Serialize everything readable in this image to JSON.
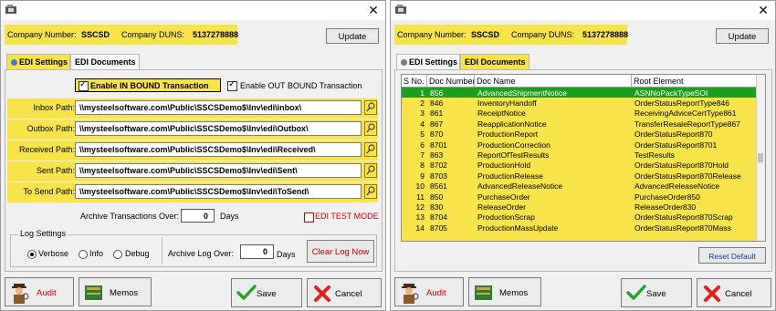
{
  "left_window": {
    "close_glyph": "✕",
    "company": {
      "number_label": "Company Number:",
      "number_value": "SSCSD",
      "duns_label": "Company DUNS:",
      "duns_value": "5137278888"
    },
    "update_button": "Update",
    "tabs": [
      {
        "label": "EDI Settings",
        "active": true
      },
      {
        "label": "EDI Documents",
        "active": false
      }
    ],
    "inbound_checkbox": {
      "label": "Enable IN BOUND Transaction",
      "checked": true
    },
    "outbound_checkbox": {
      "label": "Enable OUT BOUND Transaction",
      "checked": true
    },
    "paths": [
      {
        "label": "Inbox Path:",
        "value": "\\\\mysteelsoftware.com\\Public\\SSCSDemo$\\Inv\\edi\\inbox\\"
      },
      {
        "label": "Outbox Path:",
        "value": "\\\\mysteelsoftware.com\\Public\\SSCSDemo$\\Inv\\edi\\Outbox\\"
      },
      {
        "label": "Received Path:",
        "value": "\\\\mysteelsoftware.com\\Public\\SSCSDemo$\\Inv\\edi\\Received\\"
      },
      {
        "label": "Sent Path:",
        "value": "\\\\mysteelsoftware.com\\Public\\SSCSDemo$\\Inv\\edi\\Sent\\"
      },
      {
        "label": "To Send Path:",
        "value": "\\\\mysteelsoftware.com\\Public\\SSCSDemo$\\Inv\\edi\\ToSend\\"
      }
    ],
    "archive": {
      "label": "Archive Transactions Over:",
      "value": "0",
      "unit": "Days"
    },
    "edi_test_mode": {
      "label": "EDI TEST MODE",
      "checked": false
    },
    "log_settings": {
      "title": "Log Settings",
      "options": [
        {
          "label": "Verbose",
          "selected": true
        },
        {
          "label": "Info",
          "selected": false
        },
        {
          "label": "Debug",
          "selected": false
        }
      ],
      "archive_label": "Archive Log Over:",
      "archive_value": "0",
      "archive_unit": "Days",
      "clear_button": "Clear Log Now"
    },
    "buttons": {
      "audit": "Audit",
      "memos": "Memos",
      "save": "Save",
      "cancel": "Cancel"
    }
  },
  "right_window": {
    "close_glyph": "✕",
    "company": {
      "number_label": "Company Number:",
      "number_value": "SSCSD",
      "duns_label": "Company DUNS:",
      "duns_value": "5137278888"
    },
    "update_button": "Update",
    "tabs": [
      {
        "label": "EDI Settings",
        "active": false
      },
      {
        "label": "EDI Documents",
        "active": true
      }
    ],
    "grid": {
      "columns": [
        "S No.",
        "Doc Number",
        "Doc Name",
        "Root Element"
      ],
      "rows": [
        [
          "1",
          "856",
          "AdvancedShipmentNotice",
          "ASNNoPackTypeSOI"
        ],
        [
          "2",
          "846",
          "InventoryHandoff",
          "OrderStatusReportType846"
        ],
        [
          "3",
          "861",
          "ReceiptNotice",
          "ReceivingAdviceCertType861"
        ],
        [
          "4",
          "867",
          "ReapplicationNotice",
          "TransferResaleReportType867"
        ],
        [
          "5",
          "870",
          "ProductionReport",
          "OrderStatusReport870"
        ],
        [
          "6",
          "8701",
          "ProductionCorrection",
          "OrderStatusReport8701"
        ],
        [
          "7",
          "863",
          "ReportOfTestResults",
          "TestResults"
        ],
        [
          "8",
          "8702",
          "ProductionHold",
          "OrderStatusReport870Hold"
        ],
        [
          "9",
          "8703",
          "ProductionRelease",
          "OrderStatusReport870Release"
        ],
        [
          "10",
          "8561",
          "AdvancedReleaseNotice",
          "AdvancedReleaseNotice"
        ],
        [
          "11",
          "850",
          "PurchaseOrder",
          "PurchaseOrder850"
        ],
        [
          "12",
          "830",
          "ReleaseOrder",
          "ReleaseOrder830"
        ],
        [
          "13",
          "8704",
          "ProductionScrap",
          "OrderStatusReport870Scrap"
        ],
        [
          "14",
          "8705",
          "ProductionMassUpdate",
          "OrderStatusReport870Mass"
        ]
      ],
      "selected_row": 0
    },
    "reset_button": "Reset Default",
    "buttons": {
      "audit": "Audit",
      "memos": "Memos",
      "save": "Save",
      "cancel": "Cancel"
    }
  },
  "colors": {
    "highlight": "#f7e34a",
    "selected_row": "#1e9e1e",
    "hyperlink_red": "#cc0000"
  }
}
